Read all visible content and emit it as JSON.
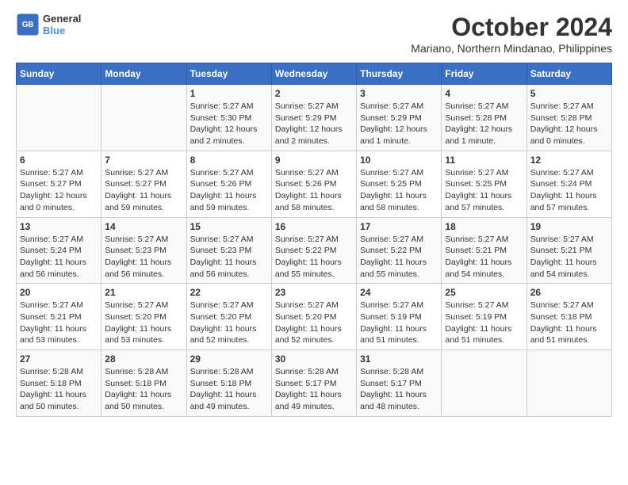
{
  "logo": {
    "text_general": "General",
    "text_blue": "Blue"
  },
  "title": "October 2024",
  "subtitle": "Mariano, Northern Mindanao, Philippines",
  "weekdays": [
    "Sunday",
    "Monday",
    "Tuesday",
    "Wednesday",
    "Thursday",
    "Friday",
    "Saturday"
  ],
  "weeks": [
    [
      {
        "day": "",
        "content": ""
      },
      {
        "day": "",
        "content": ""
      },
      {
        "day": "1",
        "content": "Sunrise: 5:27 AM\nSunset: 5:30 PM\nDaylight: 12 hours and 2 minutes."
      },
      {
        "day": "2",
        "content": "Sunrise: 5:27 AM\nSunset: 5:29 PM\nDaylight: 12 hours and 2 minutes."
      },
      {
        "day": "3",
        "content": "Sunrise: 5:27 AM\nSunset: 5:29 PM\nDaylight: 12 hours and 1 minute."
      },
      {
        "day": "4",
        "content": "Sunrise: 5:27 AM\nSunset: 5:28 PM\nDaylight: 12 hours and 1 minute."
      },
      {
        "day": "5",
        "content": "Sunrise: 5:27 AM\nSunset: 5:28 PM\nDaylight: 12 hours and 0 minutes."
      }
    ],
    [
      {
        "day": "6",
        "content": "Sunrise: 5:27 AM\nSunset: 5:27 PM\nDaylight: 12 hours and 0 minutes."
      },
      {
        "day": "7",
        "content": "Sunrise: 5:27 AM\nSunset: 5:27 PM\nDaylight: 11 hours and 59 minutes."
      },
      {
        "day": "8",
        "content": "Sunrise: 5:27 AM\nSunset: 5:26 PM\nDaylight: 11 hours and 59 minutes."
      },
      {
        "day": "9",
        "content": "Sunrise: 5:27 AM\nSunset: 5:26 PM\nDaylight: 11 hours and 58 minutes."
      },
      {
        "day": "10",
        "content": "Sunrise: 5:27 AM\nSunset: 5:25 PM\nDaylight: 11 hours and 58 minutes."
      },
      {
        "day": "11",
        "content": "Sunrise: 5:27 AM\nSunset: 5:25 PM\nDaylight: 11 hours and 57 minutes."
      },
      {
        "day": "12",
        "content": "Sunrise: 5:27 AM\nSunset: 5:24 PM\nDaylight: 11 hours and 57 minutes."
      }
    ],
    [
      {
        "day": "13",
        "content": "Sunrise: 5:27 AM\nSunset: 5:24 PM\nDaylight: 11 hours and 56 minutes."
      },
      {
        "day": "14",
        "content": "Sunrise: 5:27 AM\nSunset: 5:23 PM\nDaylight: 11 hours and 56 minutes."
      },
      {
        "day": "15",
        "content": "Sunrise: 5:27 AM\nSunset: 5:23 PM\nDaylight: 11 hours and 56 minutes."
      },
      {
        "day": "16",
        "content": "Sunrise: 5:27 AM\nSunset: 5:22 PM\nDaylight: 11 hours and 55 minutes."
      },
      {
        "day": "17",
        "content": "Sunrise: 5:27 AM\nSunset: 5:22 PM\nDaylight: 11 hours and 55 minutes."
      },
      {
        "day": "18",
        "content": "Sunrise: 5:27 AM\nSunset: 5:21 PM\nDaylight: 11 hours and 54 minutes."
      },
      {
        "day": "19",
        "content": "Sunrise: 5:27 AM\nSunset: 5:21 PM\nDaylight: 11 hours and 54 minutes."
      }
    ],
    [
      {
        "day": "20",
        "content": "Sunrise: 5:27 AM\nSunset: 5:21 PM\nDaylight: 11 hours and 53 minutes."
      },
      {
        "day": "21",
        "content": "Sunrise: 5:27 AM\nSunset: 5:20 PM\nDaylight: 11 hours and 53 minutes."
      },
      {
        "day": "22",
        "content": "Sunrise: 5:27 AM\nSunset: 5:20 PM\nDaylight: 11 hours and 52 minutes."
      },
      {
        "day": "23",
        "content": "Sunrise: 5:27 AM\nSunset: 5:20 PM\nDaylight: 11 hours and 52 minutes."
      },
      {
        "day": "24",
        "content": "Sunrise: 5:27 AM\nSunset: 5:19 PM\nDaylight: 11 hours and 51 minutes."
      },
      {
        "day": "25",
        "content": "Sunrise: 5:27 AM\nSunset: 5:19 PM\nDaylight: 11 hours and 51 minutes."
      },
      {
        "day": "26",
        "content": "Sunrise: 5:27 AM\nSunset: 5:18 PM\nDaylight: 11 hours and 51 minutes."
      }
    ],
    [
      {
        "day": "27",
        "content": "Sunrise: 5:28 AM\nSunset: 5:18 PM\nDaylight: 11 hours and 50 minutes."
      },
      {
        "day": "28",
        "content": "Sunrise: 5:28 AM\nSunset: 5:18 PM\nDaylight: 11 hours and 50 minutes."
      },
      {
        "day": "29",
        "content": "Sunrise: 5:28 AM\nSunset: 5:18 PM\nDaylight: 11 hours and 49 minutes."
      },
      {
        "day": "30",
        "content": "Sunrise: 5:28 AM\nSunset: 5:17 PM\nDaylight: 11 hours and 49 minutes."
      },
      {
        "day": "31",
        "content": "Sunrise: 5:28 AM\nSunset: 5:17 PM\nDaylight: 11 hours and 48 minutes."
      },
      {
        "day": "",
        "content": ""
      },
      {
        "day": "",
        "content": ""
      }
    ]
  ]
}
